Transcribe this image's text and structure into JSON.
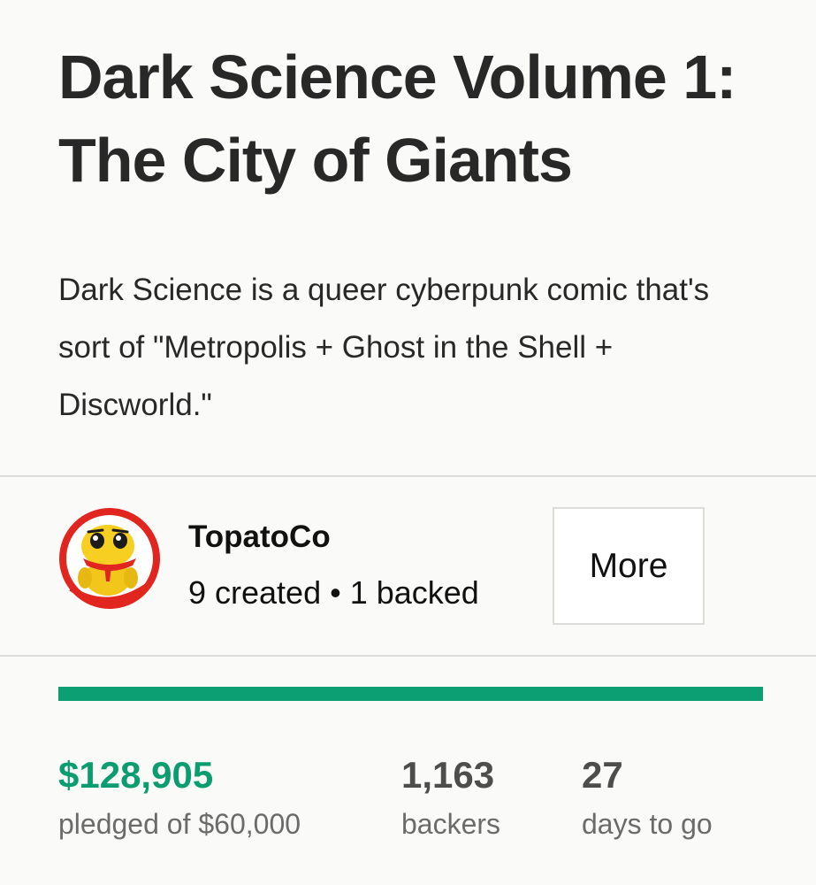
{
  "project": {
    "title": "Dark Science Volume 1: The City of Giants",
    "blurb": "Dark Science is a queer cyberpunk comic that's sort of \"Metropolis + Ghost in the Shell + Discworld.\""
  },
  "creator": {
    "name": "TopatoCo",
    "created": "9 created",
    "separator": "•",
    "backed": "1 backed",
    "avatar_icon": "duck-mascot-avatar",
    "more_label": "More"
  },
  "funding": {
    "progress_fraction": 1.0,
    "bar_color": "#0c9f74",
    "pledged_value": "$128,905",
    "pledged_label": "pledged of $60,000",
    "backers_value": "1,163",
    "backers_label": "backers",
    "days_value": "27",
    "days_label": "days to go"
  },
  "colors": {
    "accent": "#0c9f74",
    "text": "#282828",
    "muted": "#6b6b6b",
    "background": "#fafaf8"
  }
}
